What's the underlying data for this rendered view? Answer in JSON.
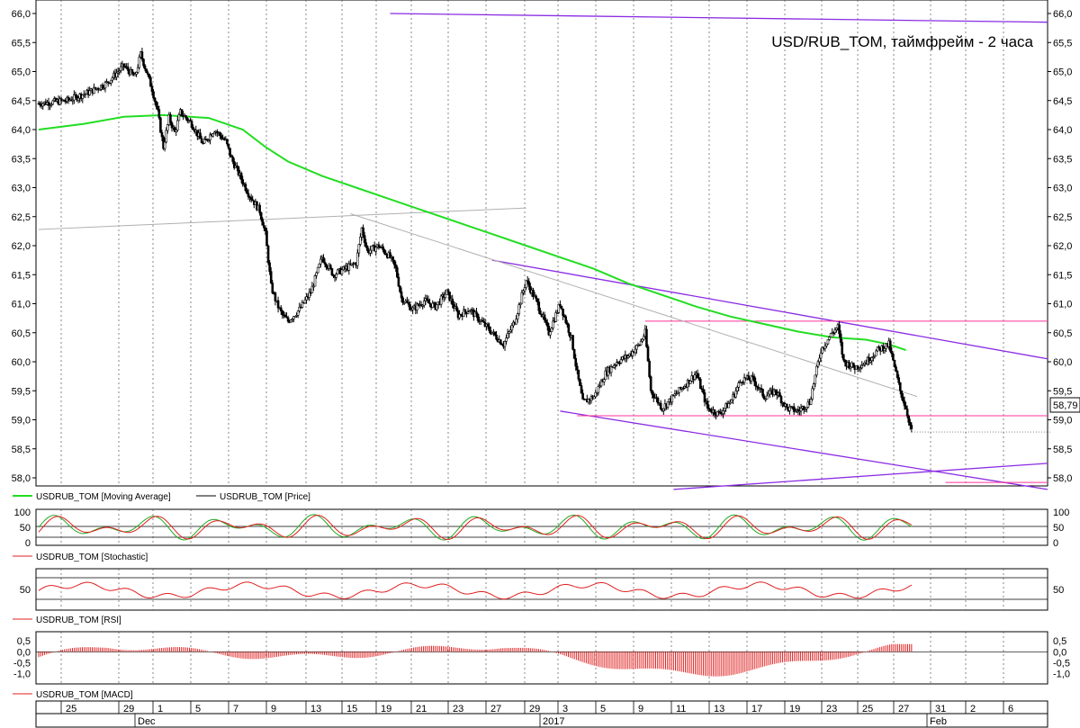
{
  "chart_data": [
    {
      "type": "candlestick",
      "title": "USD/RUB_TOM, таймфрейм - 2 часа",
      "ylim": [
        57.8,
        66.0
      ],
      "y_ticks": [
        "66,0",
        "65,5",
        "65,0",
        "64,5",
        "64,0",
        "63,5",
        "63,0",
        "62,5",
        "62,0",
        "61,5",
        "61,0",
        "60,5",
        "60,0",
        "59,5",
        "59,0",
        "58,5",
        "58,0"
      ],
      "y_tick_values": [
        66.0,
        65.5,
        65.0,
        64.5,
        64.0,
        63.5,
        63.0,
        62.5,
        62.0,
        61.5,
        61.0,
        60.5,
        60.0,
        59.5,
        59.0,
        58.5,
        58.0
      ],
      "last_price_label": "58,79",
      "last_price": 58.79,
      "legend": [
        "USDRUB_TOM [Moving Average]",
        "USDRUB_TOM [Price]"
      ],
      "colors": {
        "price": "#000000",
        "moving_average": "#22dd22",
        "trend_line": "#8a2be2",
        "level_line": "#ff3399",
        "gray_line": "#b0b0b0"
      },
      "price_path": [
        [
          0,
          64.45
        ],
        [
          5,
          64.5
        ],
        [
          9,
          64.65
        ],
        [
          12,
          64.8
        ],
        [
          15,
          65.1
        ],
        [
          17,
          64.9
        ],
        [
          18,
          65.3
        ],
        [
          20,
          64.7
        ],
        [
          21,
          64.3
        ],
        [
          22,
          63.7
        ],
        [
          23,
          64.2
        ],
        [
          24,
          63.95
        ],
        [
          25,
          64.3
        ],
        [
          27,
          64.1
        ],
        [
          29,
          63.75
        ],
        [
          31,
          64.0
        ],
        [
          33,
          63.8
        ],
        [
          34,
          63.5
        ],
        [
          35,
          63.3
        ],
        [
          37,
          62.9
        ],
        [
          39,
          62.6
        ],
        [
          40,
          62.2
        ],
        [
          41,
          61.3
        ],
        [
          42,
          61.0
        ],
        [
          43,
          60.8
        ],
        [
          44,
          60.7
        ],
        [
          46,
          60.9
        ],
        [
          48,
          61.2
        ],
        [
          50,
          61.8
        ],
        [
          52,
          61.5
        ],
        [
          54,
          61.6
        ],
        [
          56,
          61.7
        ],
        [
          57,
          62.3
        ],
        [
          58,
          61.9
        ],
        [
          60,
          62.0
        ],
        [
          62,
          61.8
        ],
        [
          63,
          61.6
        ],
        [
          64,
          61.1
        ],
        [
          66,
          60.9
        ],
        [
          68,
          61.05
        ],
        [
          70,
          60.95
        ],
        [
          72,
          61.2
        ],
        [
          74,
          60.8
        ],
        [
          76,
          60.9
        ],
        [
          78,
          60.7
        ],
        [
          80,
          60.5
        ],
        [
          82,
          60.3
        ],
        [
          84,
          60.7
        ],
        [
          86,
          61.4
        ],
        [
          88,
          61.0
        ],
        [
          90,
          60.5
        ],
        [
          92,
          61.0
        ],
        [
          94,
          60.4
        ],
        [
          95,
          59.8
        ],
        [
          96,
          59.3
        ],
        [
          98,
          59.4
        ],
        [
          100,
          59.8
        ],
        [
          102,
          60.0
        ],
        [
          104,
          60.1
        ],
        [
          106,
          60.3
        ],
        [
          107,
          60.5
        ],
        [
          108,
          59.5
        ],
        [
          110,
          59.2
        ],
        [
          112,
          59.4
        ],
        [
          114,
          59.6
        ],
        [
          116,
          59.8
        ],
        [
          117,
          59.5
        ],
        [
          118,
          59.2
        ],
        [
          120,
          59.1
        ],
        [
          122,
          59.3
        ],
        [
          124,
          59.7
        ],
        [
          126,
          59.7
        ],
        [
          128,
          59.4
        ],
        [
          130,
          59.5
        ],
        [
          132,
          59.2
        ],
        [
          134,
          59.15
        ],
        [
          136,
          59.3
        ],
        [
          138,
          60.2
        ],
        [
          140,
          60.5
        ],
        [
          141,
          60.6
        ],
        [
          142,
          60.0
        ],
        [
          144,
          59.9
        ],
        [
          146,
          60.0
        ],
        [
          148,
          60.2
        ],
        [
          150,
          60.3
        ],
        [
          151,
          59.9
        ],
        [
          152,
          59.5
        ],
        [
          153,
          59.2
        ],
        [
          154,
          58.8
        ]
      ],
      "moving_average": [
        [
          0,
          64.0
        ],
        [
          8,
          64.1
        ],
        [
          15,
          64.22
        ],
        [
          22,
          64.25
        ],
        [
          30,
          64.2
        ],
        [
          36,
          64.0
        ],
        [
          40,
          63.7
        ],
        [
          44,
          63.45
        ],
        [
          50,
          63.2
        ],
        [
          56,
          63.0
        ],
        [
          62,
          62.8
        ],
        [
          68,
          62.6
        ],
        [
          74,
          62.4
        ],
        [
          80,
          62.2
        ],
        [
          86,
          62.0
        ],
        [
          92,
          61.8
        ],
        [
          98,
          61.6
        ],
        [
          104,
          61.35
        ],
        [
          110,
          61.15
        ],
        [
          116,
          60.95
        ],
        [
          122,
          60.78
        ],
        [
          128,
          60.65
        ],
        [
          134,
          60.52
        ],
        [
          140,
          60.42
        ],
        [
          146,
          60.38
        ],
        [
          150,
          60.3
        ],
        [
          153,
          60.2
        ]
      ],
      "trend_lines": [
        {
          "color": "purple",
          "from": [
            62,
            66.0
          ],
          "to": [
            178,
            65.85
          ]
        },
        {
          "color": "purple",
          "from": [
            80,
            61.75
          ],
          "to": [
            178,
            60.05
          ]
        },
        {
          "color": "purple",
          "from": [
            92,
            59.15
          ],
          "to": [
            178,
            57.8
          ]
        },
        {
          "color": "purple",
          "from": [
            112,
            57.8
          ],
          "to": [
            178,
            58.25
          ]
        },
        {
          "color": "pink",
          "from": [
            107,
            60.7
          ],
          "to": [
            178,
            60.7
          ]
        },
        {
          "color": "pink",
          "from": [
            95,
            59.07
          ],
          "to": [
            178,
            59.07
          ]
        },
        {
          "color": "pink",
          "from": [
            160,
            57.92
          ],
          "to": [
            178,
            57.92
          ]
        },
        {
          "color": "gray",
          "from": [
            0,
            62.28
          ],
          "to": [
            86,
            62.65
          ]
        },
        {
          "color": "gray",
          "from": [
            55,
            62.55
          ],
          "to": [
            155,
            59.4
          ]
        }
      ]
    },
    {
      "type": "line",
      "name": "USDRUB_TOM [Stochastic]",
      "y_ticks": [
        "100",
        "50",
        "0"
      ],
      "y_tick_values": [
        100,
        50,
        0
      ],
      "ylim": [
        0,
        100
      ]
    },
    {
      "type": "line",
      "name": "USDRUB_TOM [RSI]",
      "y_ticks": [
        "50"
      ],
      "y_tick_values": [
        50
      ],
      "ylim": [
        20,
        80
      ]
    },
    {
      "type": "bar",
      "name": "USDRUB_TOM [MACD]",
      "y_ticks": [
        "0,5",
        "0,0",
        "-0,5",
        "-1,0"
      ],
      "y_tick_values": [
        0.5,
        0.0,
        -0.5,
        -1.0
      ],
      "ylim": [
        -1.3,
        0.75
      ]
    }
  ],
  "x_axis": {
    "day_labels": [
      "25",
      "29",
      "1",
      "5",
      "7",
      "9",
      "13",
      "15",
      "19",
      "21",
      "23",
      "27",
      "29",
      "3",
      "5",
      "9",
      "11",
      "13",
      "17",
      "19",
      "23",
      "25",
      "27",
      "31",
      "2",
      "6"
    ],
    "month_labels": [
      "Dec",
      "2017",
      "Feb"
    ]
  }
}
